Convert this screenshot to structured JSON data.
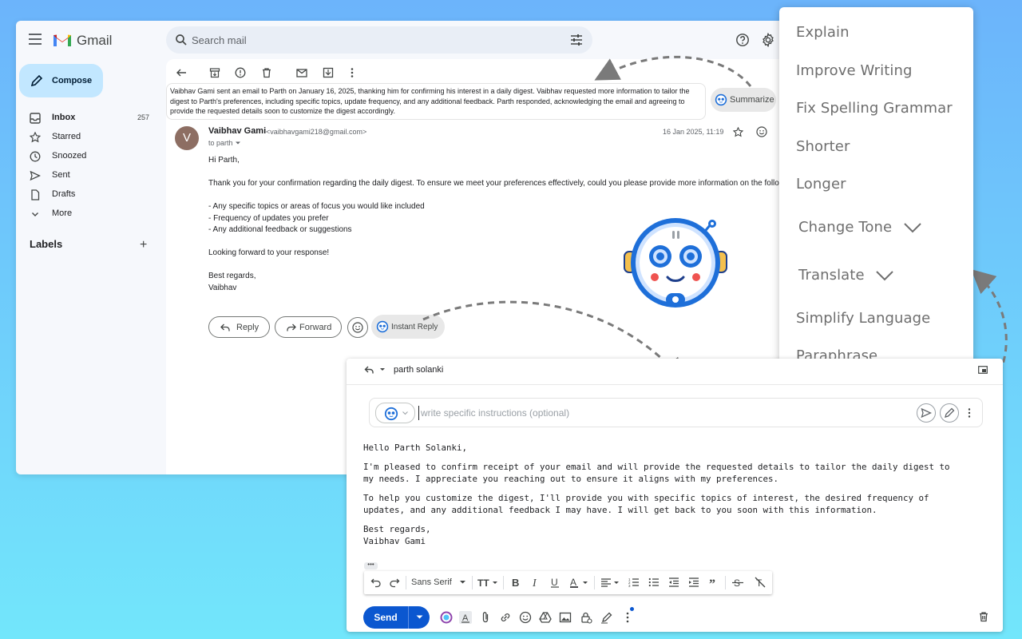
{
  "gmail": {
    "app_name": "Gmail",
    "search_placeholder": "Search mail",
    "compose_label": "Compose",
    "nav": [
      {
        "label": "Inbox",
        "count": "257",
        "icon": "inbox-icon"
      },
      {
        "label": "Starred",
        "count": "",
        "icon": "star-icon"
      },
      {
        "label": "Snoozed",
        "count": "",
        "icon": "clock-icon"
      },
      {
        "label": "Sent",
        "count": "",
        "icon": "send-icon"
      },
      {
        "label": "Drafts",
        "count": "",
        "icon": "draft-icon"
      },
      {
        "label": "More",
        "count": "",
        "icon": "chevron-down-icon"
      }
    ],
    "labels_header": "Labels",
    "labels_add": "+"
  },
  "email": {
    "summary": "Vaibhav Gami sent an email to Parth on January 16, 2025, thanking him for confirming his interest in a daily digest. Vaibhav requested more information to tailor the digest to Parth's preferences, including specific topics, update frequency, and any additional feedback. Parth responded, acknowledging the email and agreeing to provide the requested details soon to customize the digest accordingly.",
    "summarize_label": "Summarize",
    "avatar_letter": "V",
    "sender_name": "Vaibhav Gami",
    "sender_email": "<vaibhavgami218@gmail.com>",
    "to_line": "to parth",
    "date": "16 Jan 2025, 11:19",
    "body": {
      "greeting": "Hi Parth,",
      "intro": "Thank you for your confirmation regarding the daily digest. To ensure we meet your preferences effectively, could you please provide more information on the following:",
      "bullet1": "- Any specific topics or areas of focus you would like included",
      "bullet2": "- Frequency of updates you prefer",
      "bullet3": "- Any additional feedback or suggestions",
      "closing": "Looking forward to your response!",
      "signoff": "Best regards,",
      "signature": "Vaibhav"
    },
    "reply_label": "Reply",
    "forward_label": "Forward",
    "instant_reply_label": "Instant Reply"
  },
  "menu": {
    "items": [
      "Explain",
      "Improve Writing",
      "Fix Spelling Grammar",
      "Shorter",
      "Longer",
      "Change Tone",
      "Translate",
      "Simplify Language",
      "Paraphrase"
    ]
  },
  "reply_window": {
    "to": "parth solanki",
    "instructions_placeholder": "write specific instructions (optional)",
    "body": {
      "greeting": "Hello Parth Solanki,",
      "para1": "I'm pleased to confirm receipt of your email and will provide the requested details to tailor the daily digest to my needs. I appreciate you reaching out to ensure it aligns with my preferences.",
      "para2": "To help you customize the digest, I'll provide you with specific topics of interest, the desired frequency of updates, and any additional feedback I may have. I will get back to you soon with this information.",
      "signoff": "Best regards,",
      "signature": "Vaibhav Gami"
    },
    "font_name": "Sans Serif",
    "ellipsis": "•••",
    "send_label": "Send"
  },
  "colors": {
    "accent": "#0b57d0",
    "compose_bg": "#c2e7ff",
    "robot_blue": "#1e6fd9"
  }
}
